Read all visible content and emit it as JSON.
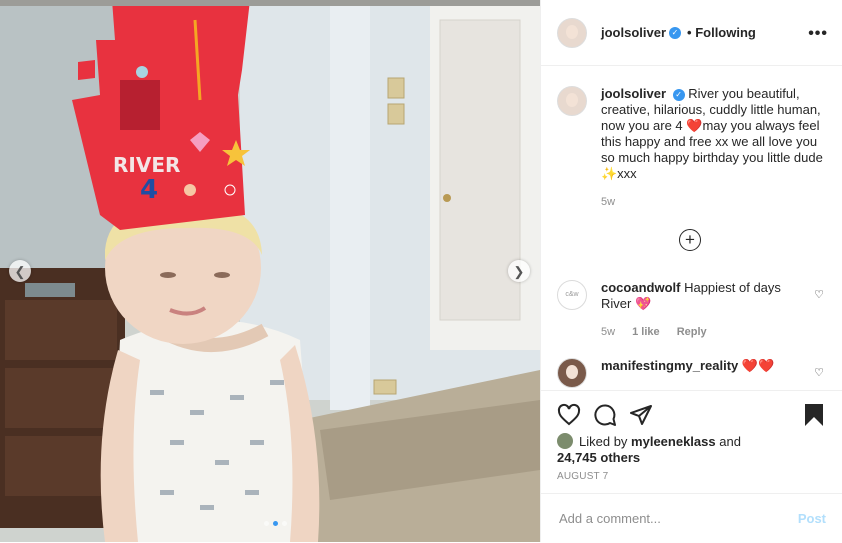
{
  "post": {
    "username": "joolsoliver",
    "verified_mark": "✓",
    "follow_status": "• Following",
    "more_icon": "•••"
  },
  "caption": {
    "username": "joolsoliver",
    "text": "River you beautiful, creative, hilarious, cuddly little human, now you are 4 ❤️may you always feel this happy and free xx we all love you so much happy birthday you little dude ✨xxx",
    "age": "5w"
  },
  "comments": [
    {
      "username": "cocoandwolf",
      "avatar_text": "c&w",
      "text": "Happiest of days River 💖",
      "age": "5w",
      "likes": "1 like",
      "reply": "Reply"
    },
    {
      "username": "manifestingmy_reality",
      "text": "❤️❤️"
    }
  ],
  "load_more_icon": "+",
  "likes": {
    "prefix": "Liked by",
    "user": "myleeneklass",
    "and": "and",
    "count": "24,745 others"
  },
  "date": "AUGUST 7",
  "add_comment": {
    "placeholder": "Add a comment...",
    "post_label": "Post"
  },
  "photo": {
    "crown_text": "RIVER",
    "crown_number": "4"
  },
  "icons": [
    "heart-icon",
    "comment-icon",
    "share-icon",
    "bookmark-icon",
    "chevron-left-icon",
    "chevron-right-icon"
  ],
  "colors": {
    "accent": "#3897f0",
    "post_disabled": "#b2dffc",
    "heart_red": "#ed4956"
  }
}
